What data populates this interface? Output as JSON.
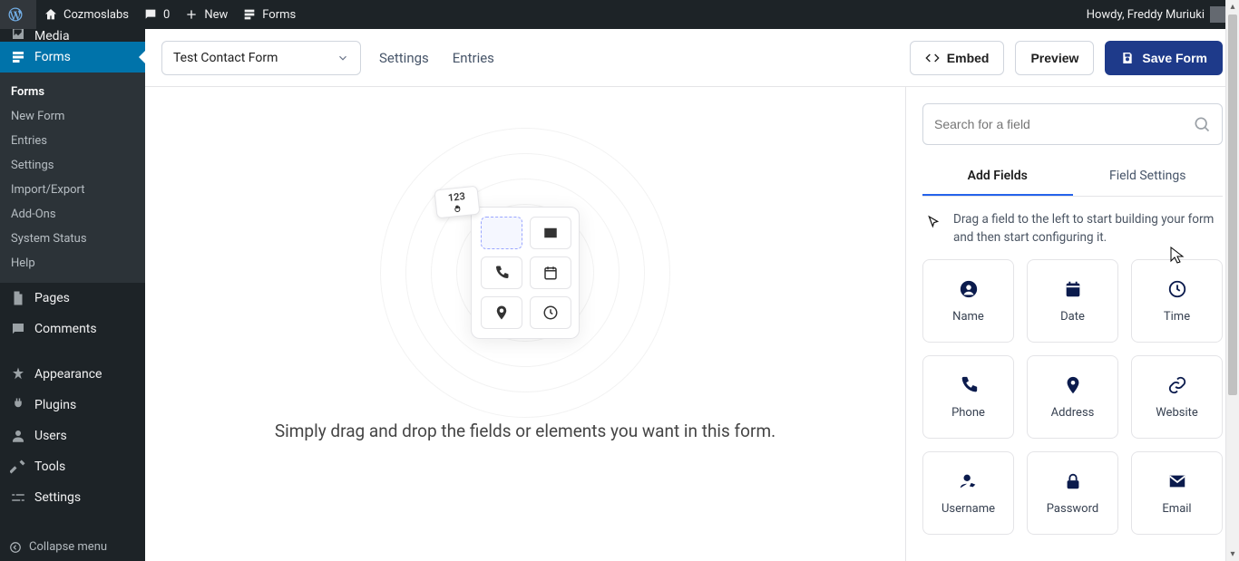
{
  "adminbar": {
    "site_name": "Cozmoslabs",
    "comments_count": "0",
    "new_label": "New",
    "forms_label": "Forms",
    "howdy": "Howdy, Freddy Muriuki"
  },
  "sidebar": {
    "media_label": "Media",
    "forms_label": "Forms",
    "forms_submenu": [
      {
        "label": "Forms",
        "active": true
      },
      {
        "label": "New Form",
        "active": false
      },
      {
        "label": "Entries",
        "active": false
      },
      {
        "label": "Settings",
        "active": false
      },
      {
        "label": "Import/Export",
        "active": false
      },
      {
        "label": "Add-Ons",
        "active": false
      },
      {
        "label": "System Status",
        "active": false
      },
      {
        "label": "Help",
        "active": false
      }
    ],
    "pages_label": "Pages",
    "comments_label": "Comments",
    "appearance_label": "Appearance",
    "plugins_label": "Plugins",
    "users_label": "Users",
    "tools_label": "Tools",
    "settings_label": "Settings",
    "collapse_label": "Collapse menu"
  },
  "topbar": {
    "form_name": "Test Contact Form",
    "settings_label": "Settings",
    "entries_label": "Entries",
    "embed_label": "Embed",
    "preview_label": "Preview",
    "save_label": "Save Form"
  },
  "canvas": {
    "placeholder_float_text": "123",
    "instruction": "Simply drag and drop the fields or elements you want in this form."
  },
  "panel": {
    "search_placeholder": "Search for a field",
    "tab_add_fields": "Add Fields",
    "tab_field_settings": "Field Settings",
    "hint_text": "Drag a field to the left to start building your form and then start configuring it.",
    "fields": [
      {
        "label": "Name",
        "icon": "user-circle"
      },
      {
        "label": "Date",
        "icon": "calendar"
      },
      {
        "label": "Time",
        "icon": "clock"
      },
      {
        "label": "Phone",
        "icon": "phone"
      },
      {
        "label": "Address",
        "icon": "map-pin"
      },
      {
        "label": "Website",
        "icon": "link"
      },
      {
        "label": "Username",
        "icon": "user-edit"
      },
      {
        "label": "Password",
        "icon": "lock"
      },
      {
        "label": "Email",
        "icon": "mail"
      }
    ]
  }
}
